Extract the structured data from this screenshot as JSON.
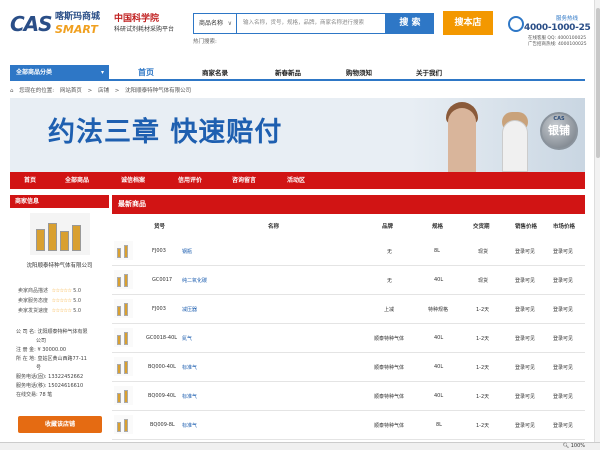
{
  "header": {
    "logo_cas": "CAS",
    "logo_cn": "喀斯玛商城",
    "logo_smart": "SMART",
    "org_title": "中国科学院",
    "org_subtitle": "科研试剂耗材采购平台",
    "search_select": "商品名称",
    "search_placeholder": "输入名称，货号，规格，品牌，商家名称进行搜索",
    "search_button": "搜 索",
    "search_store_button": "搜本店",
    "hot_search": "热门搜索:",
    "hotline_label": "服务热线",
    "hotline_number": "4000-1000-25",
    "hotline_qq1": "在线客服 QQ: 4000100025",
    "hotline_qq2": "广告招商热线: 4000100025"
  },
  "nav": {
    "category": "全部商品分类",
    "items": [
      "首页",
      "商家名录",
      "新春新品",
      "购物须知",
      "关于我们"
    ]
  },
  "breadcrumb": [
    "您现在的位置:",
    "网站首页",
    ">",
    "店铺",
    ">",
    "沈阳顺泰特种气体有限公司"
  ],
  "banner": {
    "slogan": "约法三章  快速赔付",
    "badge": "银铺",
    "badge_top": "CAS"
  },
  "red_tabs": [
    "首页",
    "全部商品",
    "诚信档案",
    "信用评价",
    "咨询留言",
    "活动区"
  ],
  "sidebar": {
    "title": "商家信息",
    "company": "沈阳顺泰特种气体有限公司",
    "ratings": [
      {
        "label": "卖家商品描述",
        "stars": "☆☆☆☆☆",
        "score": "5.0"
      },
      {
        "label": "卖家服务态度",
        "stars": "☆☆☆☆☆",
        "score": "5.0"
      },
      {
        "label": "卖家发货速度",
        "stars": "☆☆☆☆☆",
        "score": "5.0"
      }
    ],
    "info": [
      "公 司 名: 沈阳顺泰特种气体有限",
      "　　　　公司",
      "注 册 金: ¥ 30000.00",
      "所 在 地: 皇姑区黄山西路77-11",
      "　　　　号",
      "服务电话(固): 13322452662",
      "服务电话(移): 15024616610",
      "在线交易: 78 笔"
    ],
    "fav_button": "收藏该店铺"
  },
  "products": {
    "title": "最新商品",
    "columns": [
      "货号",
      "名称",
      "品牌",
      "规格",
      "交货期",
      "销售价格",
      "市场价格"
    ],
    "rows": [
      {
        "code": "FJ003",
        "name": "钢瓶",
        "brand": "无",
        "spec": "8L",
        "delivery": "现货",
        "price": "登录可见",
        "market": "登录可见"
      },
      {
        "code": "GC0017",
        "name": "纯二氧化碳",
        "brand": "无",
        "spec": "40L",
        "delivery": "现货",
        "price": "登录可见",
        "market": "登录可见"
      },
      {
        "code": "FJ003",
        "name": "减压器",
        "brand": "上减",
        "spec": "特种规格",
        "delivery": "1-2天",
        "price": "登录可见",
        "market": "登录可见"
      },
      {
        "code": "GC0018-40L",
        "name": "氮气",
        "brand": "顺泰特种气体",
        "spec": "40L",
        "delivery": "1-2天",
        "price": "登录可见",
        "market": "登录可见"
      },
      {
        "code": "BQ000-40L",
        "name": "标准气",
        "brand": "顺泰特种气体",
        "spec": "40L",
        "delivery": "1-2天",
        "price": "登录可见",
        "market": "登录可见"
      },
      {
        "code": "BQ009-40L",
        "name": "标准气",
        "brand": "顺泰特种气体",
        "spec": "40L",
        "delivery": "1-2天",
        "price": "登录可见",
        "market": "登录可见"
      },
      {
        "code": "BQ009-8L",
        "name": "标准气",
        "brand": "顺泰特种气体",
        "spec": "8L",
        "delivery": "1-2天",
        "price": "登录可见",
        "market": "登录可见"
      }
    ]
  },
  "status": {
    "zoom": "100%"
  }
}
